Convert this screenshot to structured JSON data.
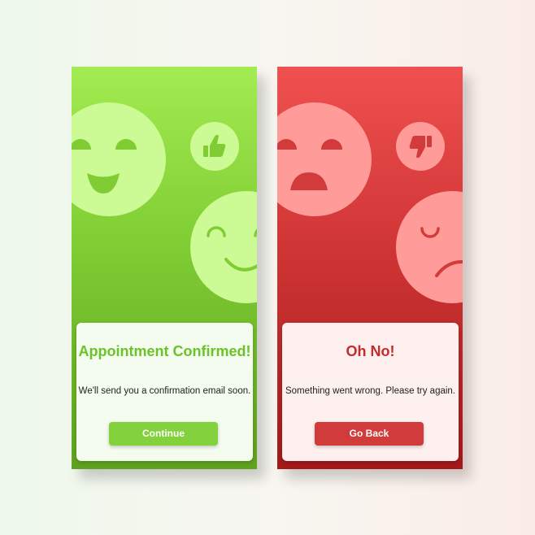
{
  "success": {
    "title": "Appointment Confirmed!",
    "message": "We'll send you a confirmation email soon.",
    "button_label": "Continue",
    "colors": {
      "accent": "#7fcc33",
      "blob": "#ccfb95",
      "feature": "#7fcc33"
    }
  },
  "error": {
    "title": "Oh No!",
    "message": "Something went wrong. Please try again.",
    "button_label": "Go Back",
    "colors": {
      "accent": "#d13b3b",
      "blob": "#ff9c9a",
      "feature": "#d13b3b"
    }
  }
}
